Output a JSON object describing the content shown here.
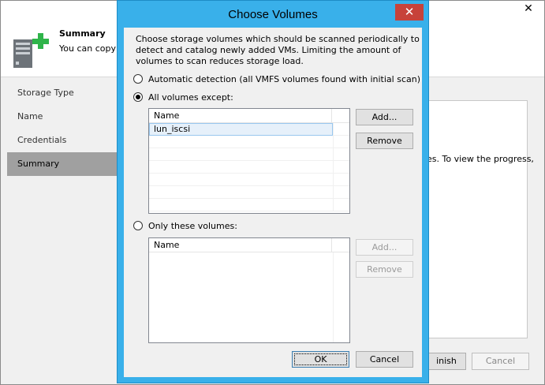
{
  "background_wizard": {
    "close_glyph": "✕",
    "header_title": "Summary",
    "header_description": "You can copy t",
    "nav_items": [
      "Storage Type",
      "Name",
      "Credentials",
      "Summary"
    ],
    "active_nav_index": 3,
    "content_text": "es. To view the progress,",
    "finish_label": "inish",
    "cancel_label": "Cancel"
  },
  "dialog": {
    "title": "Choose Volumes",
    "close_glyph": "✕",
    "description": "Choose storage volumes which should be scanned periodically to detect and catalog newly added VMs. Limiting the amount of volumes to scan reduces storage load.",
    "options": {
      "automatic": {
        "label": "Automatic detection (all VMFS volumes found with initial scan)",
        "checked": false
      },
      "all_except": {
        "label": "All volumes except:",
        "checked": true
      },
      "only_these": {
        "label": "Only these volumes:",
        "checked": false
      }
    },
    "except_list": {
      "column": "Name",
      "rows": [
        "lun_iscsi"
      ]
    },
    "only_list": {
      "column": "Name",
      "rows": []
    },
    "except_buttons": {
      "add": "Add...",
      "remove": "Remove"
    },
    "only_buttons": {
      "add": "Add...",
      "remove": "Remove"
    },
    "ok_label": "OK",
    "cancel_label": "Cancel"
  },
  "colors": {
    "dialog_frame": "#39b0ea",
    "close_button": "#c7423a",
    "selection_fill": "#e6f0fa",
    "nav_active": "#a0a0a0",
    "icon_plus": "#2fb44a"
  },
  "icons": [
    "server-add-icon",
    "close-icon"
  ]
}
